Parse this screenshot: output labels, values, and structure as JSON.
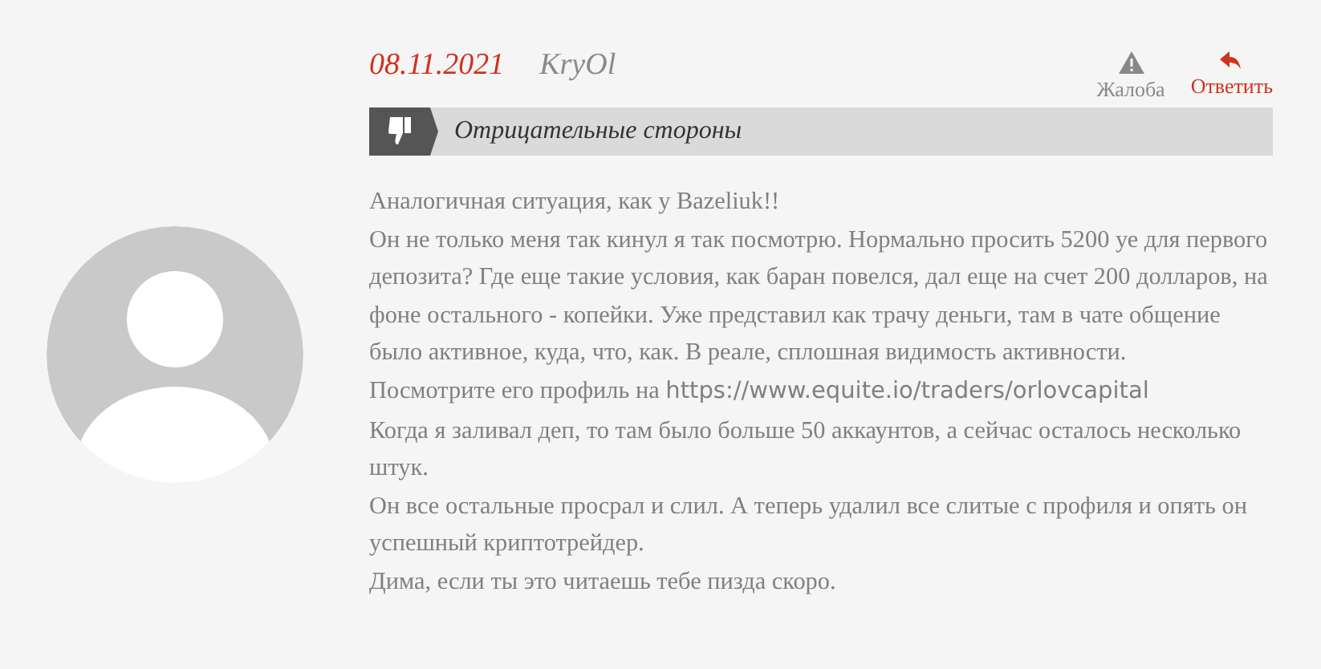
{
  "review": {
    "date": "08.11.2021",
    "author": "KryOl",
    "actions": [
      {
        "kind": "complaint",
        "label": "Жалоба"
      },
      {
        "kind": "reply",
        "label": "Ответить"
      }
    ],
    "section": {
      "kind": "negative",
      "title": "Отрицательные стороны"
    },
    "paragraphs": [
      {
        "text": "Аналогичная ситуация, как у Bazeliuk!!"
      },
      {
        "text": "Он не только меня так кинул я так посмотрю. Нормально просить 5200 уе для первого депозита? Где еще такие условия, как баран повелся, дал еще на счет 200 долларов, на фоне остального - копейки. Уже представил как трачу деньги, там в чате общение было активное, куда, что, как. В реале, сплошная видимость активности."
      },
      {
        "text": "Посмотрите его профиль на",
        "link": "https://www.equite.io/traders/orlovcapital"
      },
      {
        "text": "Когда я заливал деп, то там было больше 50 аккаунтов, а сейчас осталось несколько штук."
      },
      {
        "text": "Он все остальные просрал и слил. А теперь удалил все слитые с профиля и опять он успешный криптотрейдер."
      },
      {
        "text": "Дима, если ты это читаешь тебе пизда скоро."
      }
    ]
  }
}
